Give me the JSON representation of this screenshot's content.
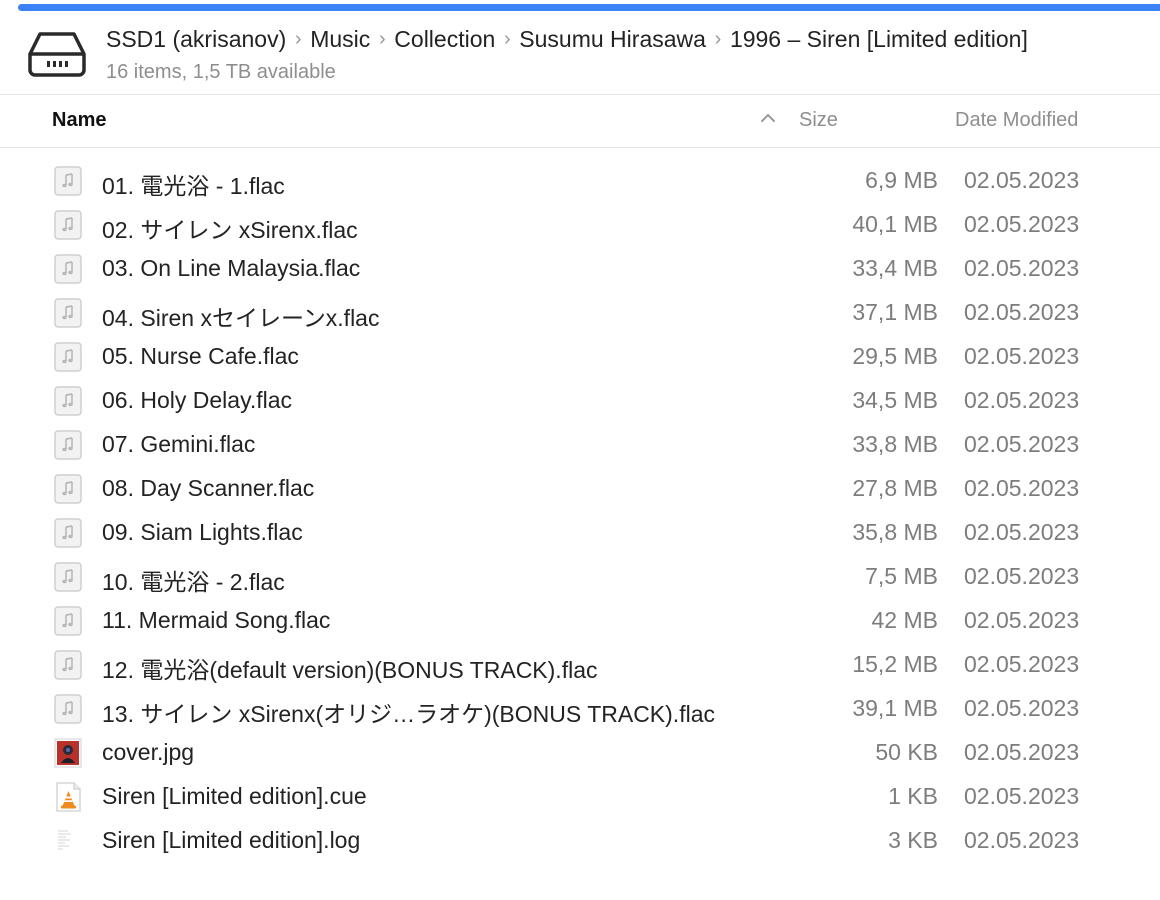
{
  "window": {
    "accent_color": "#3b82f6"
  },
  "header": {
    "drive_icon": "external-drive-icon",
    "breadcrumb": [
      "SSD1 (akrisanov)",
      "Music",
      "Collection",
      "Susumu Hirasawa",
      "1996 – Siren [Limited edition]"
    ],
    "status": "16 items, 1,5 TB available"
  },
  "columns": {
    "name": "Name",
    "size": "Size",
    "date": "Date Modified",
    "sort_icon": "chevron-up-icon"
  },
  "files": [
    {
      "name": "01. 電光浴 - 1.flac",
      "size": "6,9 MB",
      "date": "02.05.2023",
      "icon": "audio-file-icon"
    },
    {
      "name": "02. サイレン xSirenx.flac",
      "size": "40,1 MB",
      "date": "02.05.2023",
      "icon": "audio-file-icon"
    },
    {
      "name": "03. On Line Malaysia.flac",
      "size": "33,4 MB",
      "date": "02.05.2023",
      "icon": "audio-file-icon"
    },
    {
      "name": "04. Siren xセイレーンx.flac",
      "size": "37,1 MB",
      "date": "02.05.2023",
      "icon": "audio-file-icon"
    },
    {
      "name": "05. Nurse Cafe.flac",
      "size": "29,5 MB",
      "date": "02.05.2023",
      "icon": "audio-file-icon"
    },
    {
      "name": "06. Holy Delay.flac",
      "size": "34,5 MB",
      "date": "02.05.2023",
      "icon": "audio-file-icon"
    },
    {
      "name": "07. Gemini.flac",
      "size": "33,8 MB",
      "date": "02.05.2023",
      "icon": "audio-file-icon"
    },
    {
      "name": "08. Day Scanner.flac",
      "size": "27,8 MB",
      "date": "02.05.2023",
      "icon": "audio-file-icon"
    },
    {
      "name": "09. Siam Lights.flac",
      "size": "35,8 MB",
      "date": "02.05.2023",
      "icon": "audio-file-icon"
    },
    {
      "name": "10. 電光浴 - 2.flac",
      "size": "7,5 MB",
      "date": "02.05.2023",
      "icon": "audio-file-icon"
    },
    {
      "name": "11. Mermaid Song.flac",
      "size": "42 MB",
      "date": "02.05.2023",
      "icon": "audio-file-icon"
    },
    {
      "name": "12. 電光浴(default version)(BONUS TRACK).flac",
      "size": "15,2 MB",
      "date": "02.05.2023",
      "icon": "audio-file-icon"
    },
    {
      "name": "13. サイレン xSirenx(オリジ…ラオケ)(BONUS TRACK).flac",
      "size": "39,1 MB",
      "date": "02.05.2023",
      "icon": "audio-file-icon"
    },
    {
      "name": "cover.jpg",
      "size": "50 KB",
      "date": "02.05.2023",
      "icon": "image-thumbnail-icon"
    },
    {
      "name": "Siren [Limited edition].cue",
      "size": "1 KB",
      "date": "02.05.2023",
      "icon": "vlc-cone-icon"
    },
    {
      "name": "Siren [Limited edition].log",
      "size": "3 KB",
      "date": "02.05.2023",
      "icon": "text-document-icon"
    }
  ]
}
